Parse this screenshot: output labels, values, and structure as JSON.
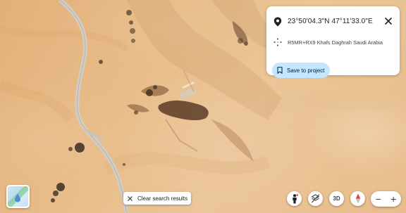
{
  "info_card": {
    "coordinates": "23°50'04.3\"N 47°11'33.0\"E",
    "plus_code": "R5MR+RX9 Khafs Daghrah Saudi Arabia",
    "save_label": "Save to project",
    "icons": {
      "location": "location-pin-icon",
      "plus_code": "plus-code-icon",
      "save": "bookmark-icon",
      "close": "close-icon"
    }
  },
  "controls": {
    "clear_search_label": "Clear search results",
    "three_d_label": "3D",
    "zoom_in_label": "+",
    "zoom_out_label": "−"
  },
  "colors": {
    "save_button_bg": "#c2e7ff",
    "desert_base": "#e5b886",
    "road": "#c9c6c0",
    "compass_red": "#ea4335"
  }
}
